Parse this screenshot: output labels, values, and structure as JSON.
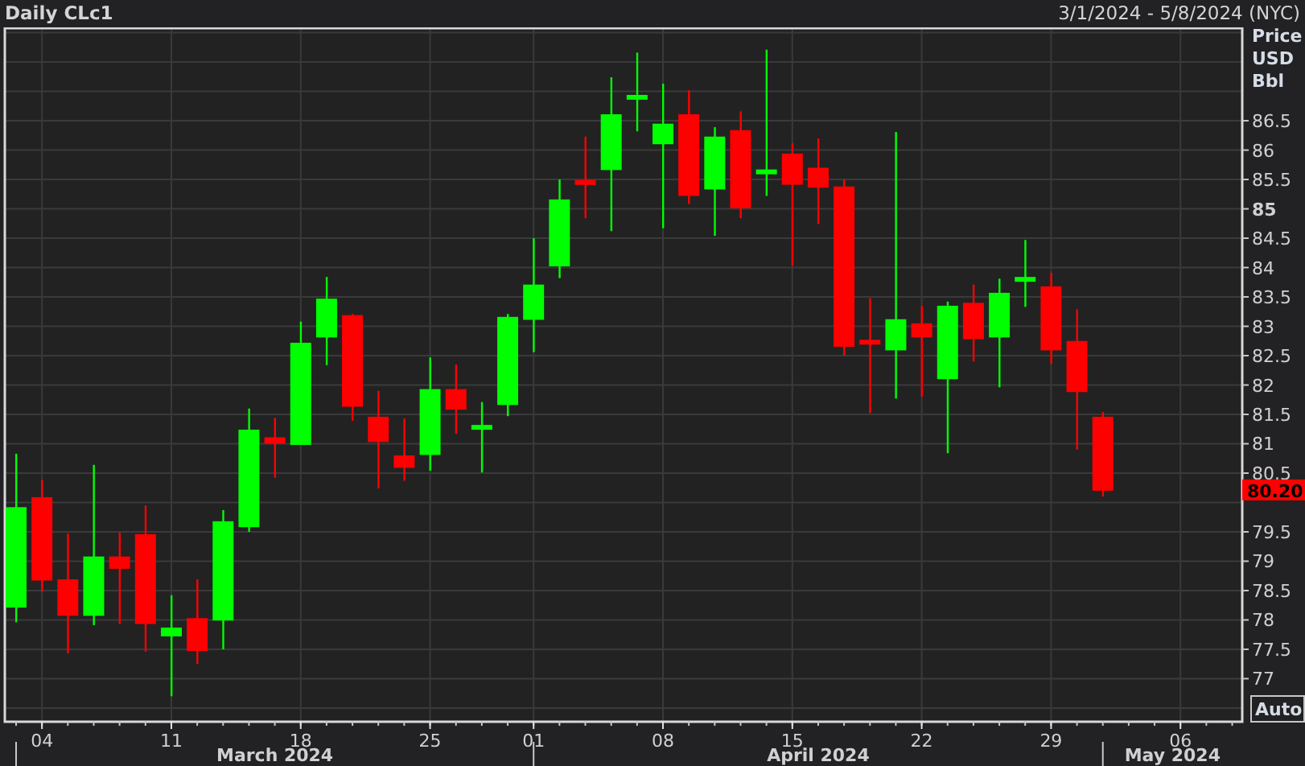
{
  "header": {
    "range": "3/1/2024 - 5/8/2024 (NYC)"
  },
  "month_labels": [
    {
      "label": "March 2024"
    },
    {
      "label": "April 2024"
    },
    {
      "label": "May 2024"
    }
  ],
  "price_axis": {
    "units": [
      "Price",
      "USD",
      "Bbl"
    ],
    "auto_button": "Auto"
  },
  "chart_data": {
    "type": "candlestick",
    "title": "Daily CLc1",
    "ylim": [
      76.28,
      88.09
    ],
    "categories": [
      null,
      "04",
      null,
      null,
      null,
      null,
      "11",
      null,
      null,
      null,
      null,
      "18",
      null,
      null,
      null,
      null,
      "25",
      null,
      null,
      null,
      "01",
      null,
      null,
      null,
      null,
      "08",
      null,
      null,
      null,
      null,
      "15",
      null,
      null,
      null,
      null,
      "22",
      null,
      null,
      null,
      null,
      "29",
      null,
      null,
      null,
      null,
      "06"
    ],
    "series": [
      {
        "ohlc": [
          [
            78.21,
            80.83,
            77.96,
            79.92
          ],
          [
            80.09,
            80.38,
            78.48,
            78.67
          ],
          [
            78.69,
            79.47,
            77.43,
            78.07
          ],
          [
            78.07,
            80.64,
            77.91,
            79.08
          ],
          [
            79.08,
            79.49,
            77.93,
            78.87
          ],
          [
            79.46,
            79.95,
            77.46,
            77.93
          ],
          [
            77.72,
            78.42,
            76.7,
            77.87
          ],
          [
            78.03,
            78.69,
            77.25,
            77.47
          ],
          [
            77.99,
            79.87,
            77.5,
            79.68
          ],
          [
            79.58,
            81.6,
            79.5,
            81.24
          ],
          [
            81.11,
            81.44,
            80.42,
            81.0
          ],
          [
            80.98,
            83.08,
            80.98,
            82.72
          ],
          [
            82.81,
            83.84,
            82.34,
            83.47
          ],
          [
            83.19,
            83.21,
            81.39,
            81.63
          ],
          [
            81.46,
            81.9,
            80.24,
            81.03
          ],
          [
            80.8,
            81.43,
            80.37,
            80.59
          ],
          [
            80.81,
            82.47,
            80.54,
            81.93
          ],
          [
            81.93,
            82.35,
            81.17,
            81.58
          ],
          [
            81.25,
            81.71,
            80.51,
            81.32
          ],
          [
            81.66,
            83.21,
            81.47,
            83.16
          ],
          [
            83.11,
            84.5,
            82.56,
            83.71
          ],
          [
            84.02,
            85.5,
            83.82,
            85.16
          ],
          [
            85.49,
            86.23,
            84.84,
            85.41
          ],
          [
            85.66,
            87.24,
            84.62,
            86.61
          ],
          [
            86.87,
            87.66,
            86.32,
            86.94
          ],
          [
            86.1,
            87.13,
            84.67,
            86.45
          ],
          [
            86.61,
            87.02,
            85.08,
            85.22
          ],
          [
            85.33,
            86.39,
            84.54,
            86.23
          ],
          [
            86.34,
            86.66,
            84.84,
            85.01
          ],
          [
            85.6,
            87.71,
            85.22,
            85.67
          ],
          [
            85.94,
            86.12,
            84.03,
            85.41
          ],
          [
            85.7,
            86.2,
            84.74,
            85.36
          ],
          [
            85.38,
            85.5,
            82.5,
            82.65
          ],
          [
            82.77,
            83.48,
            81.52,
            82.71
          ],
          [
            82.59,
            86.31,
            81.77,
            83.12
          ],
          [
            83.05,
            83.35,
            81.8,
            82.81
          ],
          [
            82.1,
            83.42,
            80.84,
            83.35
          ],
          [
            83.4,
            83.71,
            82.4,
            82.78
          ],
          [
            82.81,
            83.81,
            81.96,
            83.57
          ],
          [
            83.8,
            84.47,
            83.33,
            83.84
          ],
          [
            83.68,
            83.91,
            82.36,
            82.59
          ],
          [
            82.75,
            83.29,
            80.9,
            81.88
          ],
          [
            81.46,
            81.54,
            80.1,
            80.2
          ],
          null,
          null,
          null
        ]
      }
    ],
    "yticks": [
      {
        "value": 86.5,
        "label": "86.5"
      },
      {
        "value": 86,
        "label": "86"
      },
      {
        "value": 85.5,
        "label": "85.5"
      },
      {
        "value": 85,
        "label": "85"
      },
      {
        "value": 84.5,
        "label": "84.5"
      },
      {
        "value": 84,
        "label": "84"
      },
      {
        "value": 83.5,
        "label": "83.5"
      },
      {
        "value": 83,
        "label": "83"
      },
      {
        "value": 82.5,
        "label": "82.5"
      },
      {
        "value": 82,
        "label": "82"
      },
      {
        "value": 81.5,
        "label": "81.5"
      },
      {
        "value": 81,
        "label": "81"
      },
      {
        "value": 80.5,
        "label": "80.5"
      },
      {
        "value": 79.5,
        "label": "79.5"
      },
      {
        "value": 79,
        "label": "79"
      },
      {
        "value": 78.5,
        "label": "78.5"
      },
      {
        "value": 78,
        "label": "78"
      },
      {
        "value": 77.5,
        "label": "77.5"
      },
      {
        "value": 77,
        "label": "77"
      }
    ],
    "grid": true,
    "ref_lines": [
      {
        "label": "80.20",
        "color": "#ff0000"
      }
    ]
  }
}
